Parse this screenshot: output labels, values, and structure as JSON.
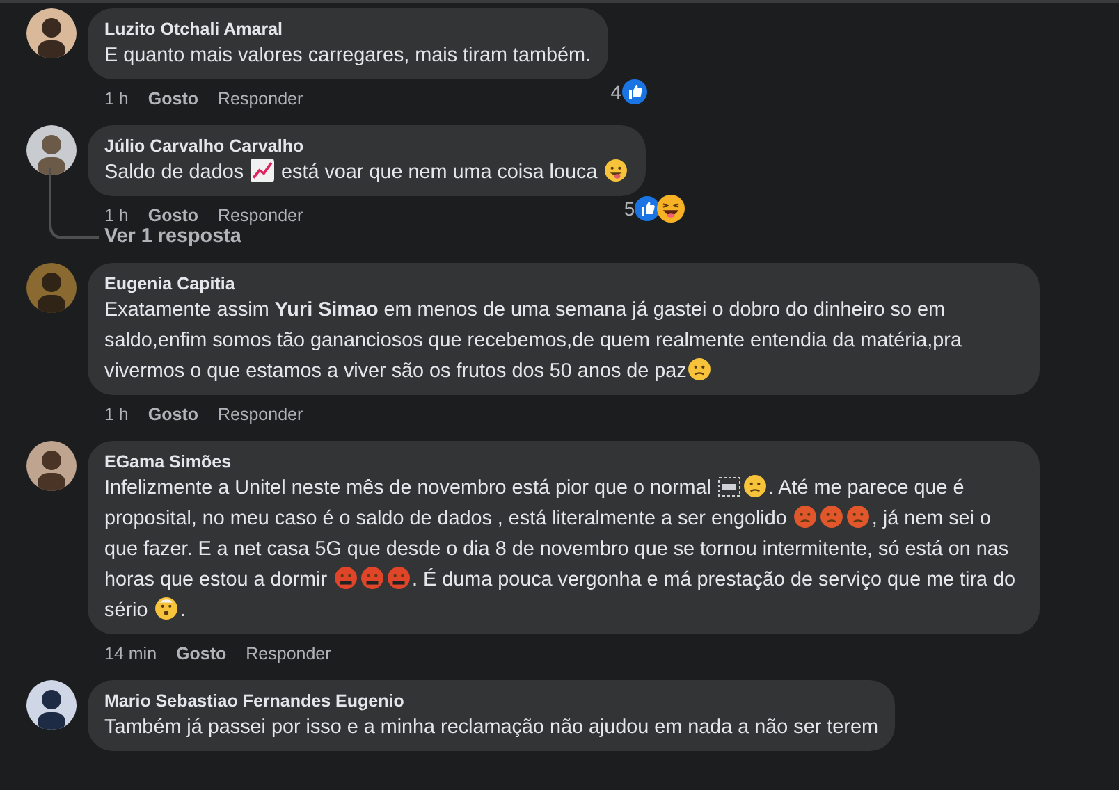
{
  "comments": [
    {
      "author": "Luzito Otchali Amaral",
      "body": [
        {
          "kind": "text",
          "text": "E quanto mais valores carregares, mais tiram também."
        }
      ],
      "time": "1 h",
      "like": "Gosto",
      "reply": "Responder",
      "reactions": {
        "count": "4",
        "icons": [
          {
            "kind": "like"
          }
        ]
      }
    },
    {
      "author": "Júlio Carvalho Carvalho",
      "body": [
        {
          "kind": "text",
          "text": "Saldo de dados "
        },
        {
          "kind": "chart"
        },
        {
          "kind": "text",
          "text": " está voar que nem uma coisa louca "
        },
        {
          "kind": "tongue"
        }
      ],
      "time": "1 h",
      "like": "Gosto",
      "reply": "Responder",
      "reactions": {
        "count": "5",
        "icons": [
          {
            "kind": "like"
          },
          {
            "kind": "laugh"
          }
        ]
      },
      "replies_link": "Ver 1 resposta"
    },
    {
      "author": "Eugenia Capitia",
      "body": [
        {
          "kind": "text",
          "text": "Exatamente assim "
        },
        {
          "kind": "mention",
          "text": "Yuri Simao"
        },
        {
          "kind": "text",
          "text": " em menos de uma semana já gastei o dobro do dinheiro so em saldo,enfim somos tão gananciosos que recebemos,de quem realmente entendia da matéria,pra vivermos o que estamos a viver são os frutos dos 50 anos de paz"
        },
        {
          "kind": "sleepy"
        }
      ],
      "time": "1 h",
      "like": "Gosto",
      "reply": "Responder"
    },
    {
      "author": "EGama Simões",
      "body": [
        {
          "kind": "text",
          "text": "Infelizmente a Unitel neste mês de novembro está pior que o normal "
        },
        {
          "kind": "obj"
        },
        {
          "kind": "sad"
        },
        {
          "kind": "text",
          "text": ". Até me parece que é proposital, no meu caso é o saldo de dados , está literalmente a ser engolido "
        },
        {
          "kind": "angry"
        },
        {
          "kind": "angry"
        },
        {
          "kind": "angry"
        },
        {
          "kind": "text",
          "text": ", já nem sei o que fazer. E a net casa 5G que desde o dia 8 de novembro que se tornou intermitente, só está on nas horas que estou a dormir "
        },
        {
          "kind": "cursing"
        },
        {
          "kind": "cursing"
        },
        {
          "kind": "cursing"
        },
        {
          "kind": "text",
          "text": ". É duma pouca vergonha e má prestação de serviço que me tira do sério "
        },
        {
          "kind": "exploding"
        },
        {
          "kind": "text",
          "text": "."
        }
      ],
      "time": "14 min",
      "like": "Gosto",
      "reply": "Responder"
    },
    {
      "author": "Mario Sebastiao Fernandes Eugenio",
      "body": [
        {
          "kind": "text",
          "text": "Também já passei por isso e a minha reclamação não ajudou em nada a não ser terem"
        }
      ]
    }
  ]
}
